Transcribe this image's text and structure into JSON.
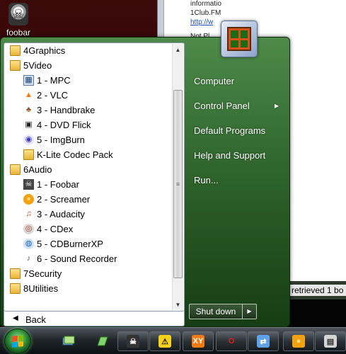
{
  "desktop": {
    "icon_label": "foobar",
    "background_window": {
      "lines": [
        "informatio",
        "1Club.FM",
        "http://w",
        "Not Pl"
      ],
      "status_text": "retrieved 1 bo"
    }
  },
  "start_menu": {
    "programs": [
      {
        "label": "4Graphics",
        "type": "folder",
        "indent": 0,
        "icon": "folder-icon"
      },
      {
        "label": "5Video",
        "type": "folder",
        "indent": 0,
        "icon": "folder-icon"
      },
      {
        "label": "1 - MPC",
        "type": "app",
        "indent": 1,
        "icon": "mpc-icon"
      },
      {
        "label": "2 - VLC",
        "type": "app",
        "indent": 1,
        "icon": "vlc-icon"
      },
      {
        "label": "3 - Handbrake",
        "type": "app",
        "indent": 1,
        "icon": "handbrake-icon"
      },
      {
        "label": "4 - DVD Flick",
        "type": "app",
        "indent": 1,
        "icon": "dvd-flick-icon"
      },
      {
        "label": "5 - ImgBurn",
        "type": "app",
        "indent": 1,
        "icon": "imgburn-icon"
      },
      {
        "label": "K-Lite Codec Pack",
        "type": "folder",
        "indent": 1,
        "icon": "folder-icon"
      },
      {
        "label": "6Audio",
        "type": "folder",
        "indent": 0,
        "icon": "folder-icon"
      },
      {
        "label": "1 - Foobar",
        "type": "app",
        "indent": 1,
        "icon": "foobar-icon"
      },
      {
        "label": "2 - Screamer",
        "type": "app",
        "indent": 1,
        "icon": "screamer-icon"
      },
      {
        "label": "3 - Audacity",
        "type": "app",
        "indent": 1,
        "icon": "audacity-icon"
      },
      {
        "label": "4 - CDex",
        "type": "app",
        "indent": 1,
        "icon": "cdex-icon"
      },
      {
        "label": "5 - CDBurnerXP",
        "type": "app",
        "indent": 1,
        "icon": "cdburnerxp-icon"
      },
      {
        "label": "6 - Sound Recorder",
        "type": "app",
        "indent": 1,
        "icon": "sound-recorder-icon"
      },
      {
        "label": "7Security",
        "type": "folder",
        "indent": 0,
        "icon": "folder-icon"
      },
      {
        "label": "8Utilities",
        "type": "folder",
        "indent": 0,
        "icon": "folder-icon"
      }
    ],
    "back_label": "Back",
    "right_items": [
      {
        "label": "Computer",
        "has_submenu": false
      },
      {
        "label": "Control Panel",
        "has_submenu": true
      },
      {
        "label": "Default Programs",
        "has_submenu": false
      },
      {
        "label": "Help and Support",
        "has_submenu": false
      },
      {
        "label": "Run...",
        "has_submenu": false
      }
    ],
    "shutdown_label": "Shut down"
  },
  "taskbar": {
    "quick_launch": [
      "show-desktop-icon",
      "switch-windows-icon"
    ],
    "buttons": [
      {
        "icon": "foobar-icon",
        "glyph": "☠"
      },
      {
        "icon": "screamer-icon",
        "glyph": "⚠"
      },
      {
        "icon": "xy-icon",
        "glyph": "XY"
      },
      {
        "icon": "opera-icon",
        "glyph": "O"
      },
      {
        "icon": "network-icon",
        "glyph": "⇄"
      },
      {
        "icon": "orange-icon",
        "glyph": "●"
      },
      {
        "icon": "printer-icon",
        "glyph": "▤"
      }
    ]
  },
  "colors": {
    "start_menu_green": "#356d33",
    "folder": "#e9b43a",
    "taskbar": "#20262b"
  }
}
